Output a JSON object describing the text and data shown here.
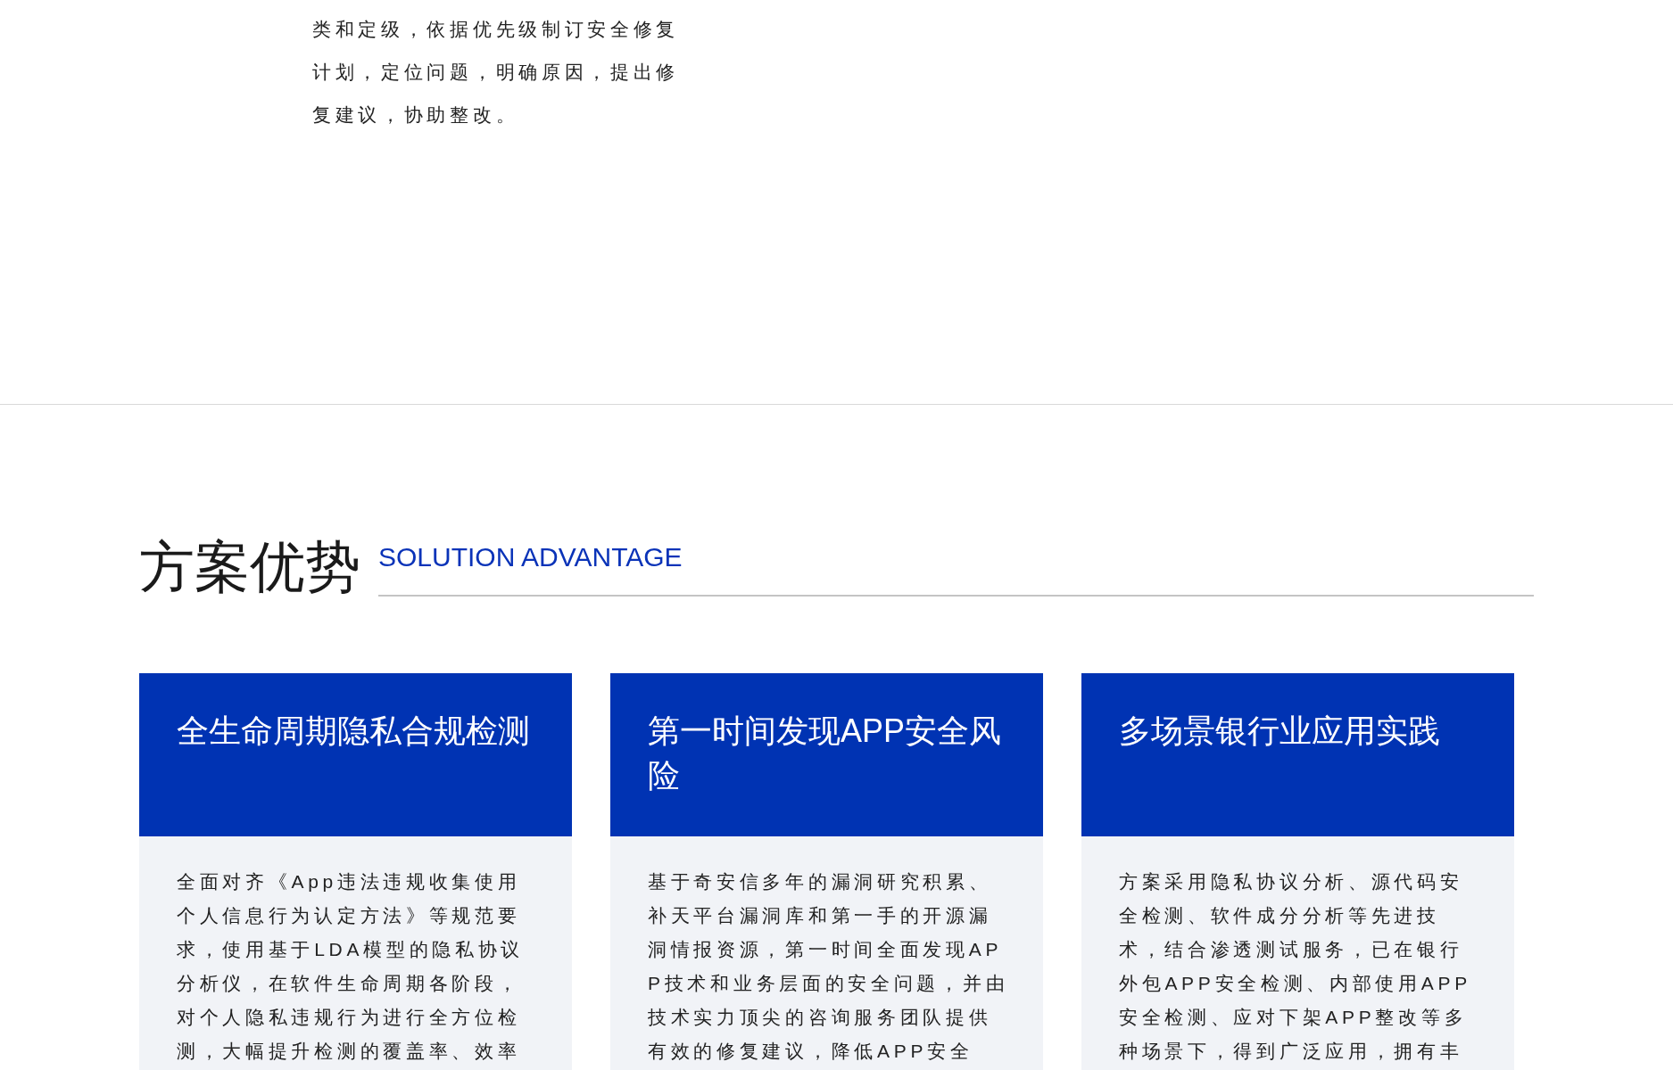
{
  "intro": {
    "text": "类和定级，依据优先级制订安全修复计划，定位问题，明确原因，提出修复建议，协助整改。"
  },
  "section": {
    "title": "方案优势",
    "subtitle": "SOLUTION ADVANTAGE"
  },
  "cards": [
    {
      "title": "全生命周期隐私合规检测",
      "body": "全面对齐《App违法违规收集使用个人信息行为认定方法》等规范要求，使用基于LDA模型的隐私协议分析仪，在软件生命周期各阶段，对个人隐私违规行为进行全方位检测，大幅提升检测的覆盖率、效率"
    },
    {
      "title": "第一时间发现APP安全风险",
      "body": "基于奇安信多年的漏洞研究积累、补天平台漏洞库和第一手的开源漏洞情报资源，第一时间全面发现APP技术和业务层面的安全问题，并由技术实力顶尖的咨询服务团队提供有效的修复建议，降低APP安全"
    },
    {
      "title": "多场景银行业应用实践",
      "body": "方案采用隐私协议分析、源代码安全检测、软件成分分析等先进技术，结合渗透测试服务，已在银行外包APP安全检测、内部使用APP安全检测、应对下架APP整改等多种场景下，得到广泛应用，拥有丰"
    }
  ]
}
